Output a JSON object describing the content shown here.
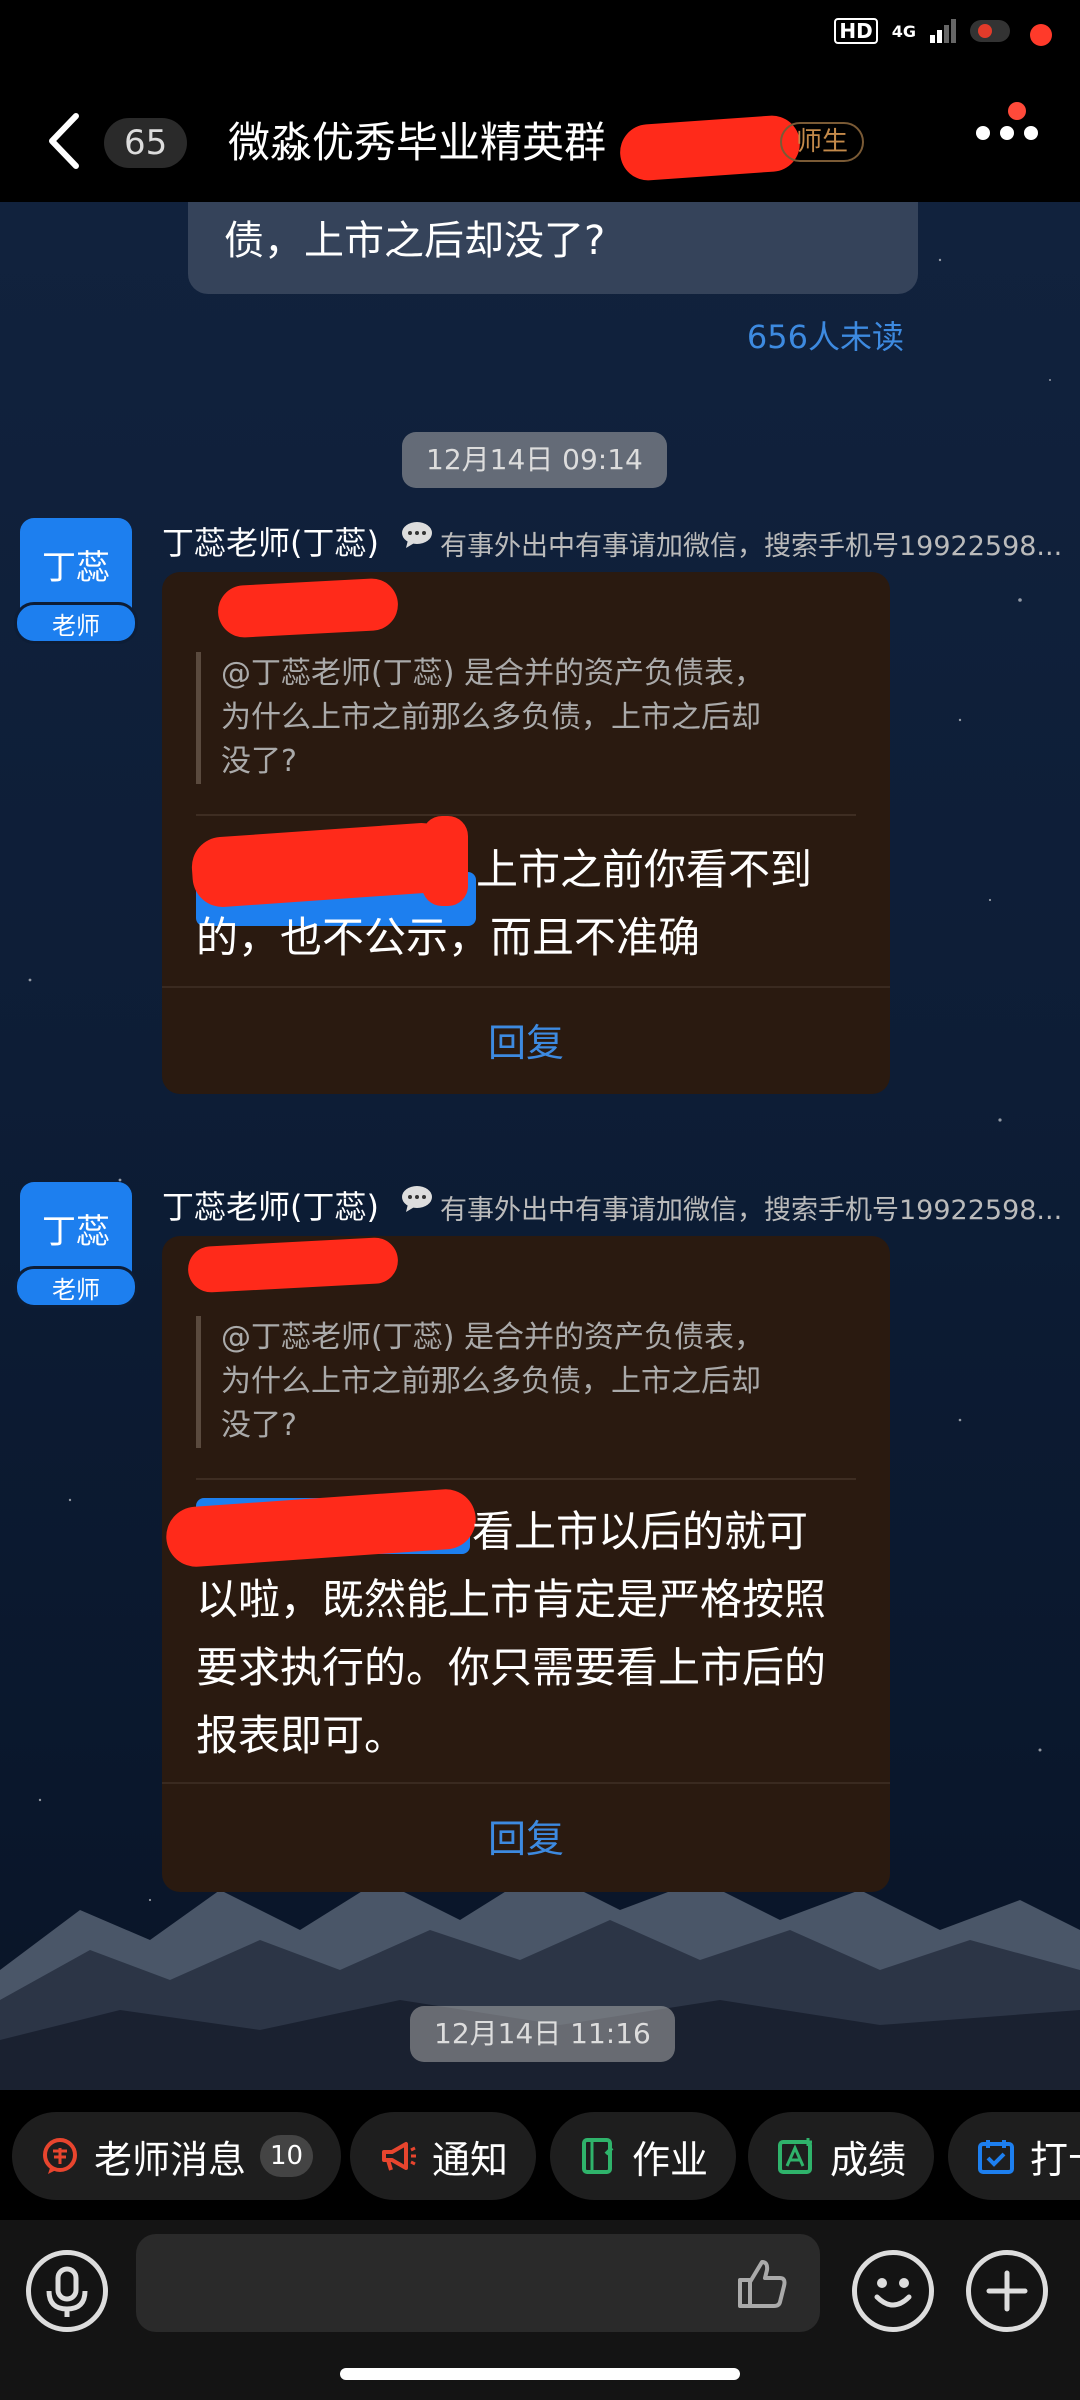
{
  "status_bar": {
    "hd": "HD",
    "network": "4G"
  },
  "header": {
    "unread_count": "65",
    "title": "微淼优秀毕业精英群",
    "role_tag": "师生"
  },
  "previous_message": {
    "text": "债，上市之后却没了?",
    "read_status": "656人未读"
  },
  "timestamps": [
    "12月14日 09:14",
    "12月14日 11:16"
  ],
  "messages": [
    {
      "avatar_name": "丁蕊",
      "avatar_badge": "老师",
      "sender": "丁蕊老师(丁蕊)",
      "sender_note": "有事外出中有事请加微信，搜索手机号19922598...",
      "quote_lines": [
        "@丁蕊老师(丁蕊) 是合并的资产负债表，",
        "为什么上市之前那么多负债，上市之后却",
        "没了?"
      ],
      "reply_lines": [
        "上市之前你看不到",
        "的，也不公示，而且不准确"
      ],
      "reply_button": "回复"
    },
    {
      "avatar_name": "丁蕊",
      "avatar_badge": "老师",
      "sender": "丁蕊老师(丁蕊)",
      "sender_note": "有事外出中有事请加微信，搜索手机号19922598...",
      "quote_lines": [
        "@丁蕊老师(丁蕊) 是合并的资产负债表，",
        "为什么上市之前那么多负债，上市之后却",
        "没了?"
      ],
      "reply_lines": [
        "看上市以后的就可",
        "以啦，既然能上市肯定是严格按照",
        "要求执行的。你只需要看上市后的",
        "报表即可。"
      ],
      "reply_button": "回复"
    }
  ],
  "toolbar": {
    "teacher_msg": "老师消息",
    "teacher_msg_count": "10",
    "notice": "通知",
    "homework": "作业",
    "grades": "成绩",
    "checkin": "打卡"
  },
  "colors": {
    "accent": "#1d7fef",
    "link": "#3d8ae0",
    "card": "#2a1a10",
    "redaction": "#ff2a1a"
  }
}
